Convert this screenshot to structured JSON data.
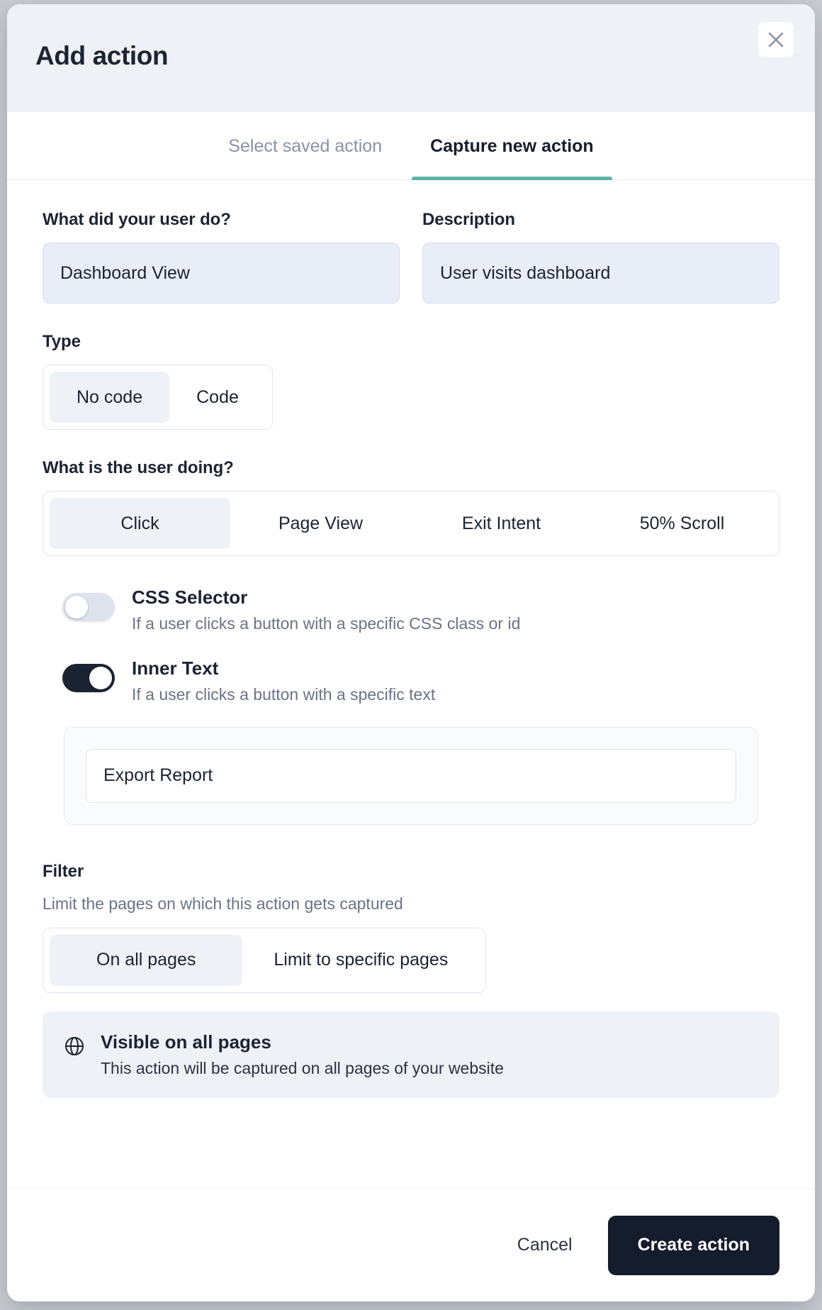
{
  "dialog": {
    "title": "Add action",
    "close_icon": "close-icon"
  },
  "tabs": [
    {
      "label": "Select saved action",
      "active": false
    },
    {
      "label": "Capture new action",
      "active": true
    }
  ],
  "form": {
    "name_field": {
      "label": "What did your user do?",
      "value": "Dashboard View",
      "placeholder": "What did your user do?"
    },
    "description_field": {
      "label": "Description",
      "value": "User visits dashboard",
      "placeholder": "Description"
    },
    "type": {
      "label": "Type",
      "options": [
        "No code",
        "Code"
      ],
      "selected": "No code"
    },
    "activity": {
      "label": "What is the user doing?",
      "options": [
        "Click",
        "Page View",
        "Exit Intent",
        "50% Scroll"
      ],
      "selected": "Click"
    },
    "toggles": [
      {
        "title": "CSS Selector",
        "description": "If a user clicks a button with a specific CSS class or id",
        "state": "off"
      },
      {
        "title": "Inner Text",
        "description": "If a user clicks a button with a specific text",
        "state": "on"
      }
    ],
    "inner_text_input": {
      "value": "Export Report",
      "placeholder": "Inner text"
    },
    "filter": {
      "label": "Filter",
      "description": "Limit the pages on which this action gets captured",
      "options": [
        "On all pages",
        "Limit to specific pages"
      ],
      "selected": "On all pages"
    },
    "info_banner": {
      "icon": "globe-icon",
      "title": "Visible on all pages",
      "description": "This action will be captured on all pages of your website"
    }
  },
  "footer": {
    "cancel_label": "Cancel",
    "create_label": "Create action"
  },
  "colors": {
    "accent": "#5fb3a8",
    "primary_button": "#151c2c",
    "input_background": "#e8edf8",
    "header_background": "#eef1f6"
  }
}
